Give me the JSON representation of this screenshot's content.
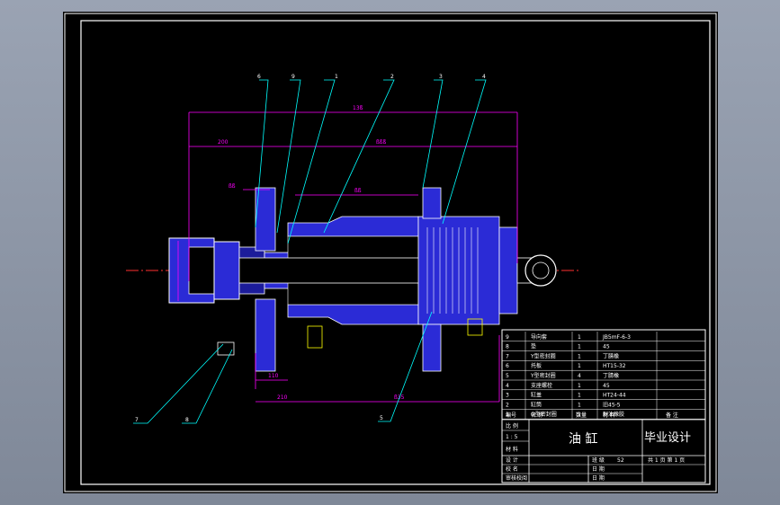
{
  "drawing": {
    "title": "油  缸",
    "subtitle": "毕业设计",
    "colors": {
      "background": "#000000",
      "frame": "#ffffff",
      "body_fill": "#2b2bd6",
      "dimension": "#ff00ff",
      "leader": "#00ffff",
      "centerline": "#ff3030",
      "outline": "#ffffff",
      "accent": "#ffff00"
    },
    "balloons": [
      "6",
      "9",
      "1",
      "2",
      "3",
      "4",
      "7",
      "8",
      "5"
    ],
    "dimensions": [
      "13ß",
      "200",
      "ßßß",
      "ßß",
      "ßß",
      "110",
      "210",
      "ß35"
    ],
    "title_block": {
      "parts": [
        {
          "no": "9",
          "name": "导向套",
          "qty": "1",
          "material": "JB5mF-6-3"
        },
        {
          "no": "8",
          "name": "垫",
          "qty": "1",
          "material": "45"
        },
        {
          "no": "7",
          "name": "Y型密封圈",
          "qty": "1",
          "material": "丁腈橡"
        },
        {
          "no": "6",
          "name": "托板",
          "qty": "1",
          "material": "HT15-32"
        },
        {
          "no": "5",
          "name": "Y型密封圈",
          "qty": "4",
          "material": "丁腈橡"
        },
        {
          "no": "4",
          "name": "支座螺栓",
          "qty": "1",
          "material": "45"
        },
        {
          "no": "3",
          "name": "缸盖",
          "qty": "1",
          "material": "HT24-44"
        },
        {
          "no": "2",
          "name": "缸筒",
          "qty": "1",
          "material": "旧45-5"
        },
        {
          "no": "1",
          "name": "O型密封圈",
          "qty": "1",
          "material": "耐油橡胶"
        }
      ],
      "header": [
        "编号",
        "名 称",
        "数量",
        "材 料",
        "备 注"
      ],
      "scale_label": "比 例",
      "scale_value": "1 : 5",
      "material_label": "材 料",
      "designer_label": "设 计",
      "checker_label": "校 名",
      "approver_label": "审核校阅",
      "class_label": "班 级",
      "class_value": "52",
      "date_label": "日 期",
      "sheet_info": "共 1 页 第 1 页"
    }
  }
}
